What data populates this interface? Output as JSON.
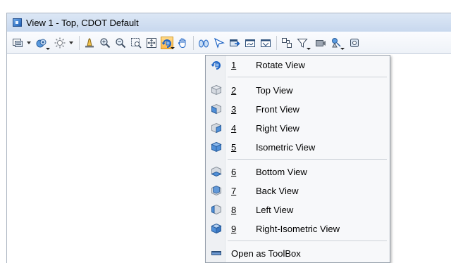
{
  "window": {
    "title": "View 1 - Top, CDOT Default"
  },
  "toolbar": {
    "icons": [
      "view-attributes-icon",
      "view-display-mode-icon",
      "lighting-icon",
      "update-view-icon",
      "zoom-in-icon",
      "zoom-out-icon",
      "window-area-icon",
      "fit-view-icon",
      "rotate-view-icon",
      "pan-view-icon",
      "view-previous-icon",
      "view-next-icon",
      "copy-view-icon",
      "clip-volume-icon",
      "clip-mask-icon"
    ],
    "active_icon": "rotate-view-icon"
  },
  "menu": {
    "items": [
      {
        "num": "1",
        "label": "Rotate View",
        "icon": "rotate-view-icon"
      },
      {
        "num": "2",
        "label": "Top View",
        "icon": "top-view-cube-icon"
      },
      {
        "num": "3",
        "label": "Front View",
        "icon": "front-view-cube-icon"
      },
      {
        "num": "4",
        "label": "Right View",
        "icon": "right-view-cube-icon"
      },
      {
        "num": "5",
        "label": "Isometric View",
        "icon": "isometric-view-cube-icon"
      },
      {
        "num": "6",
        "label": "Bottom View",
        "icon": "bottom-view-cube-icon"
      },
      {
        "num": "7",
        "label": "Back View",
        "icon": "back-view-cube-icon"
      },
      {
        "num": "8",
        "label": "Left View",
        "icon": "left-view-cube-icon"
      },
      {
        "num": "9",
        "label": "Right-Isometric View",
        "icon": "right-isometric-view-cube-icon"
      }
    ],
    "toolbox_label": "Open as ToolBox"
  },
  "colors": {
    "accent_active": "#ffb84a",
    "cube_blue": "#4f8fd8",
    "cube_gray": "#c9ced6"
  }
}
